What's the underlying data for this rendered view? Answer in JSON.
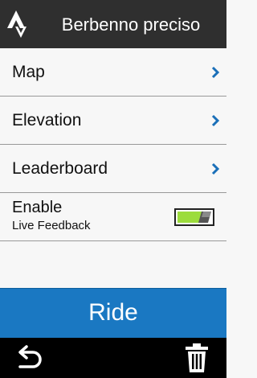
{
  "header": {
    "logo_icon": "strava-logo-icon",
    "title": "Berbenno preciso"
  },
  "menu": {
    "items": [
      {
        "label": "Map",
        "icon": "chevron-right-icon"
      },
      {
        "label": "Elevation",
        "icon": "chevron-right-icon"
      },
      {
        "label": "Leaderboard",
        "icon": "chevron-right-icon"
      }
    ]
  },
  "toggle": {
    "label_line1": "Enable",
    "label_line2": "Live Feedback",
    "state": "on",
    "on_color": "#9cdc3c"
  },
  "ride_button": {
    "label": "Ride",
    "color": "#1a78c2"
  },
  "footer": {
    "back_icon": "back-arrow-icon",
    "delete_icon": "trash-icon"
  },
  "colors": {
    "header_bg": "#2f2f2f",
    "chevron": "#1a6fb8",
    "list_bg": "#f7f7f7",
    "footer_bg": "#000000"
  }
}
